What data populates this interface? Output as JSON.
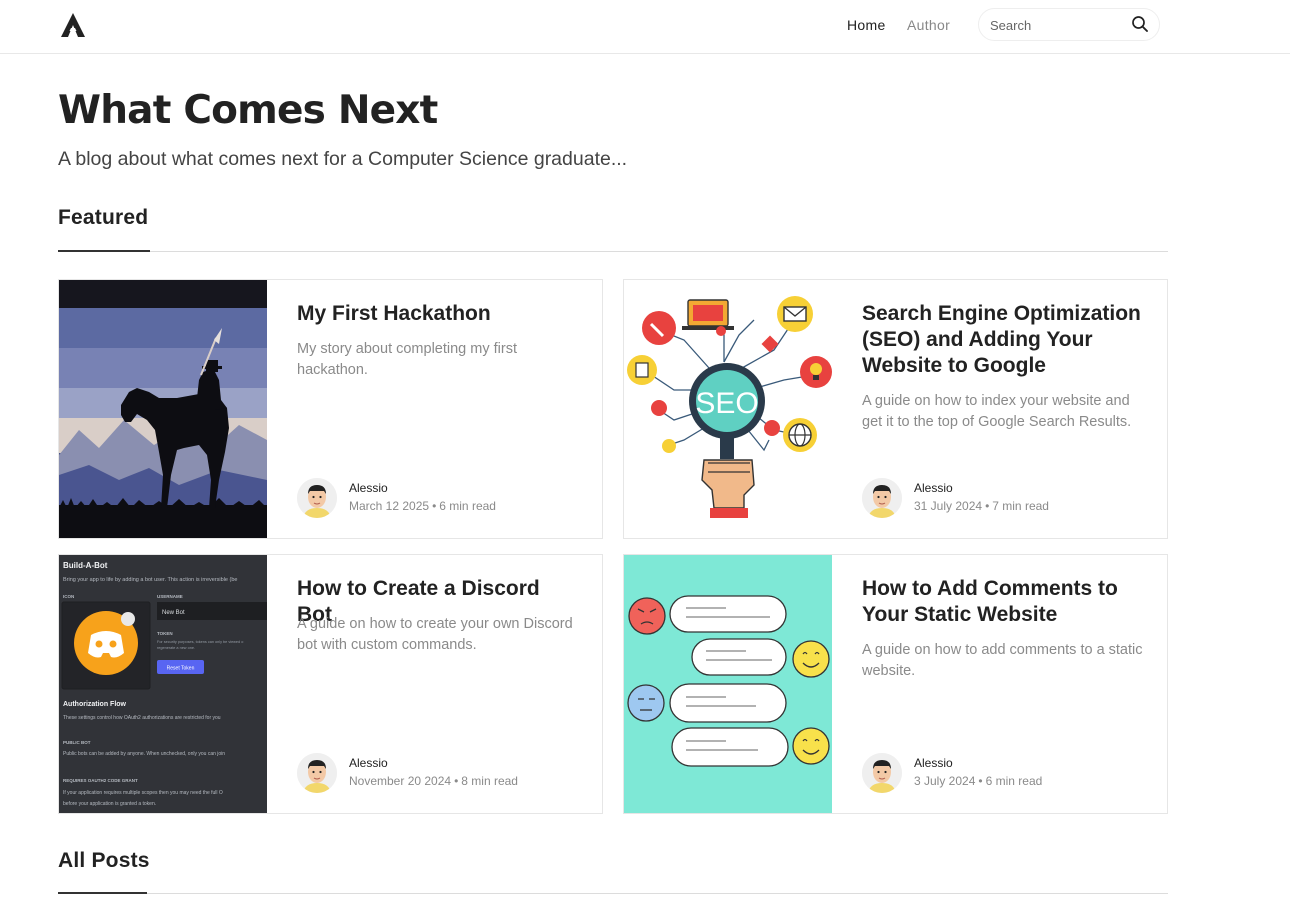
{
  "header": {
    "nav": {
      "home": "Home",
      "author": "Author"
    },
    "search": {
      "placeholder": "Search"
    }
  },
  "hero": {
    "title": "What Comes Next",
    "tagline": "A blog about what comes next for a Computer Science graduate..."
  },
  "sections": {
    "featured": "Featured",
    "all_posts": "All Posts"
  },
  "posts": [
    {
      "title": "My First Hackathon",
      "excerpt": "My story about completing my first hackathon.",
      "author": "Alessio",
      "date": "March 12 2025",
      "read_time": "6 min read"
    },
    {
      "title": "Search Engine Optimization (SEO) and Adding Your Website to Google",
      "excerpt": "A guide on how to index your website and get it to the top of Google Search Results.",
      "author": "Alessio",
      "date": "31 July 2024",
      "read_time": "7 min read",
      "thumb_text": "SEO"
    },
    {
      "title": "How to Create a Discord Bot",
      "excerpt": "A guide on how to create your own Discord bot with custom commands.",
      "author": "Alessio",
      "date": "November 20 2024",
      "read_time": "8 min read",
      "thumb": {
        "heading": "Build-A-Bot",
        "subheading": "Bring your app to life by adding a bot user. This action is irreversible (be",
        "icon_label": "ICON",
        "username_label": "USERNAME",
        "username_value": "New Bot",
        "token_label": "TOKEN",
        "token_note_1": "For security purposes, tokens can only be viewed o",
        "token_note_2": "regenerate a new one.",
        "reset_button": "Reset Token",
        "auth_heading": "Authorization Flow",
        "auth_text": "These settings control how OAuth2 authorizations are restricted for you",
        "public_bot_label": "PUBLIC BOT",
        "public_bot_text": "Public bots can be added by anyone. When unchecked, only you can join",
        "oauth_label": "REQUIRES OAUTH2 CODE GRANT",
        "oauth_text_1": "If your application requires multiple scopes then you may need the full O",
        "oauth_text_2": "before your application is granted a token."
      }
    },
    {
      "title": "How to Add Comments to Your Static Website",
      "excerpt": "A guide on how to add comments to a static website.",
      "author": "Alessio",
      "date": "3 July 2024",
      "read_time": "6 min read"
    }
  ],
  "colors": {
    "text": "#222222",
    "muted": "#8a8a8a",
    "discord_blurple": "#5865F2",
    "comments_bg": "#7EE8D6"
  }
}
